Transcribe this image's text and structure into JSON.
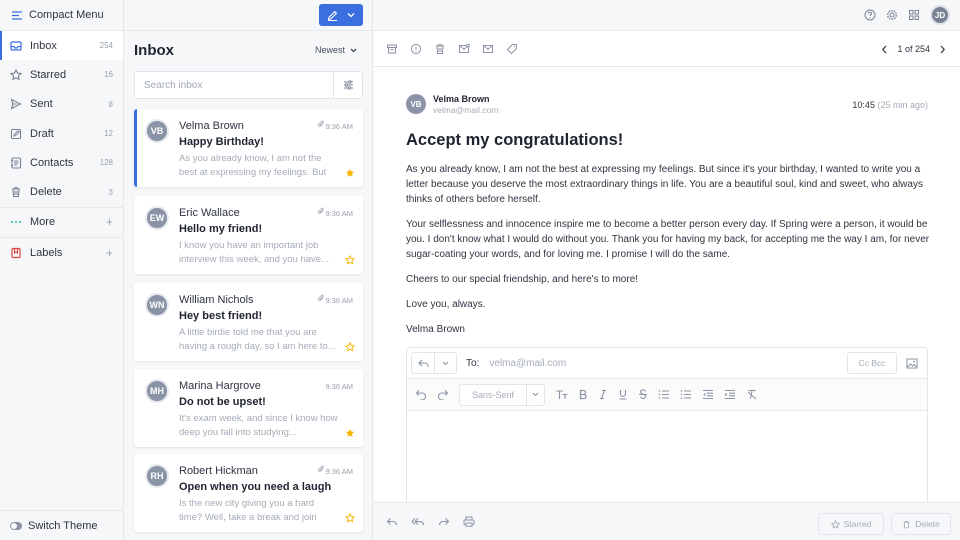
{
  "sidebar": {
    "menu_label": "Compact Menu",
    "items": [
      {
        "label": "Inbox",
        "count": "254"
      },
      {
        "label": "Starred",
        "count": "16"
      },
      {
        "label": "Sent",
        "count": "8"
      },
      {
        "label": "Draft",
        "count": "12"
      },
      {
        "label": "Contacts",
        "count": "128"
      },
      {
        "label": "Delete",
        "count": "3"
      }
    ],
    "more_label": "More",
    "labels_label": "Labels",
    "switch_theme": "Switch Theme"
  },
  "inbox": {
    "title": "Inbox",
    "sort": "Newest",
    "search_placeholder": "Search inbox",
    "messages": [
      {
        "initials": "VB",
        "name": "Velma Brown",
        "time": "9:36 AM",
        "subject": "Happy Birthday!",
        "preview": "As you already know, I am not the best at expressing my feelings. But since...",
        "starred": true
      },
      {
        "initials": "EW",
        "name": "Eric Wallace",
        "time": "9:36 AM",
        "subject": "Hello my friend!",
        "preview": "I know you have an important job interview this week, and you have...",
        "starred": false
      },
      {
        "initials": "WN",
        "name": "William Nichols",
        "time": "9:36 AM",
        "subject": "Hey best friend!",
        "preview": "A little birdie told me that you are having a rough day, so I am here to...",
        "starred": false
      },
      {
        "initials": "MH",
        "name": "Marina Hargrove",
        "time": "9:36 AM",
        "subject": "Do not be upset!",
        "preview": "It's exam week, and since I know how deep you fall into studying...",
        "starred": true
      },
      {
        "initials": "RH",
        "name": "Robert Hickman",
        "time": "9:36 AM",
        "subject": "Open when you need a laugh",
        "preview": "Is the new city giving you a hard time? Well, take a break and join me...",
        "starred": false
      }
    ]
  },
  "header": {
    "user_initials": "JD"
  },
  "reader": {
    "pager": "1 of 254",
    "sender_initials": "VB",
    "sender_name": "Velma Brown",
    "sender_email": "velma@mail.com",
    "time": "10:45",
    "time_ago": "(25 min ago)",
    "subject": "Accept my congratulations!",
    "paragraphs": [
      "As you already know, I am not the best at expressing my feelings. But since it's your birthday, I wanted to write you a letter because you deserve the most extraordinary things in life. You are a beautiful soul, kind and sweet, who always thinks of others before herself.",
      "Your selflessness and innocence inspire me to become a better person every day. If Spring were a person, it would be you. I don't know what I would do without you. Thank you for having my back, for accepting me the way I am, for never sugar-coating your words, and for loving me. I promise I will do the same.",
      "Cheers to our special friendship, and here's to more!",
      "Love you, always.",
      "Velma Brown"
    ]
  },
  "composer": {
    "to_label": "To:",
    "to_placeholder": "velma@mail.com",
    "cc_bcc": "Cc Bcc",
    "font": "Sans-Serif"
  },
  "footer": {
    "starred_label": "Starred",
    "delete_label": "Delete"
  },
  "colors": {
    "accent": "#3b6fe0",
    "star": "#f5b400",
    "labels_icon": "#e0463c"
  }
}
